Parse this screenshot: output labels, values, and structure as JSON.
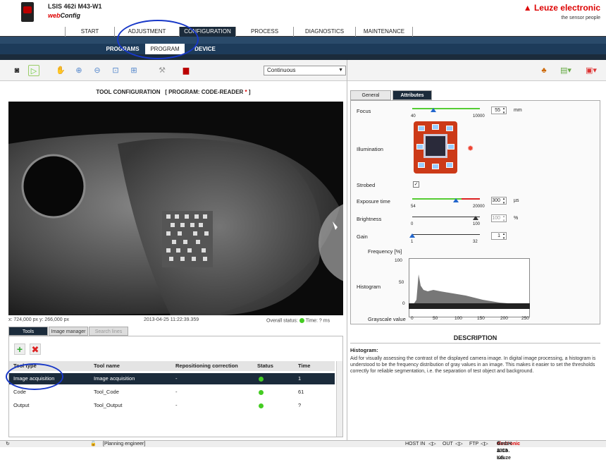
{
  "header": {
    "device_name": "LSIS 462i M43-W1",
    "app_prefix": "web",
    "app_suffix": "Config",
    "brand": "▲ Leuze electronic",
    "tagline": "the sensor people"
  },
  "menu": {
    "items": [
      "START",
      "ADJUSTMENT",
      "CONFIGURATION",
      "PROCESS",
      "DIAGNOSTICS",
      "MAINTENANCE"
    ],
    "active": "CONFIGURATION"
  },
  "submenu": {
    "items": [
      "PROGRAMS",
      "PROGRAM",
      "DEVICE"
    ],
    "active": "PROGRAM"
  },
  "toolbar": {
    "mode_value": "Continuous",
    "icons": [
      "camera-icon",
      "play-icon",
      "hand-icon",
      "zoom-in-icon",
      "zoom-out-icon",
      "zoom-fit-icon",
      "zoom-100-icon",
      "tools-icon",
      "save-icon",
      "users-icon",
      "view-icon",
      "flag-icon"
    ]
  },
  "left": {
    "title_prefix": "TOOL CONFIGURATION",
    "title_program": "[ PROGRAM: CODE-READER",
    "title_star": "*",
    "title_end": "]",
    "coords": "x: 724,000 px y: 266,000 px",
    "timestamp": "2013-04-25 11:22:39.359",
    "overall_status": "Overall status:",
    "time_text": "Time: ? ms",
    "tabs": [
      "Tools",
      "Image manager",
      "Search lines"
    ]
  },
  "tools_table": {
    "headers": [
      "Tool type",
      "Tool name",
      "Repositioning correction",
      "Status",
      "Time"
    ],
    "rows": [
      {
        "type": "Image acquisition",
        "name": "Image acquisition",
        "repos": "-",
        "time": "1"
      },
      {
        "type": "Code",
        "name": "Tool_Code",
        "repos": "-",
        "time": "61"
      },
      {
        "type": "Output",
        "name": "Tool_Output",
        "repos": "-",
        "time": "?"
      }
    ]
  },
  "right": {
    "tabs": [
      "General",
      "Attributes"
    ],
    "active_tab": "Attributes",
    "focus": {
      "label": "Focus",
      "min": "40",
      "max": "10000",
      "value": "55",
      "unit": "mm"
    },
    "illumination": {
      "label": "Illumination"
    },
    "strobed": {
      "label": "Strobed",
      "checked": "✓"
    },
    "exposure": {
      "label": "Exposure time",
      "min": "54",
      "max": "20000",
      "value": "300",
      "unit": "µs"
    },
    "brightness": {
      "label": "Brightness",
      "min": "0",
      "max": "100",
      "value": "100",
      "unit": "%"
    },
    "gain": {
      "label": "Gain",
      "min": "1",
      "max": "32",
      "value": "1"
    },
    "histogram": {
      "y_label": "Frequency [%]",
      "label": "Histogram",
      "x_label": "Grayscale value",
      "y_ticks": [
        "100",
        "50",
        "0"
      ],
      "x_ticks": [
        "0",
        "50",
        "100",
        "150",
        "200",
        "250"
      ]
    },
    "description": {
      "title": "DESCRIPTION",
      "heading": "Histogram:",
      "text": "Aid for visually assessing the contrast of the displayed camera image. In digital image processing, a histogram is understood to be the frequency distribution of gray values in an image. This makes it easier to set the thresholds correctly for reliable segmentation, i.e. the separation of test object and background."
    }
  },
  "statusbar": {
    "user": "[Planning engineer]",
    "host": "HOST IN",
    "out": "OUT",
    "ftp": "FTP",
    "copyright_a": "© 2013 Leuze",
    "copyright_b": "electronic",
    "copyright_c": "GmbH & Co. KG"
  },
  "colors": {
    "accent": "#1b2b3b",
    "brand": "#dd0000",
    "highlight": "#1838c8"
  }
}
